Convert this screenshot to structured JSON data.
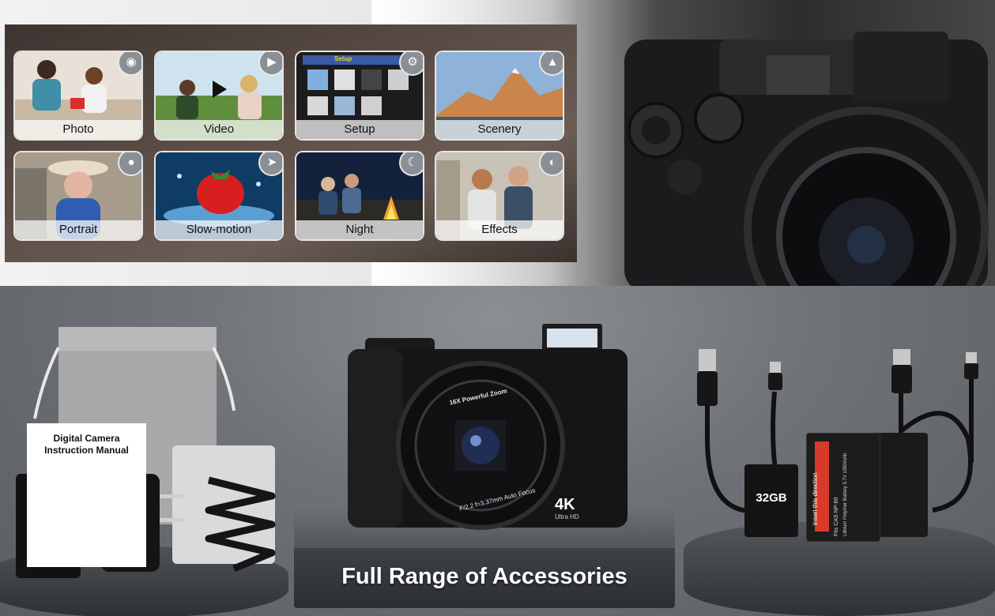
{
  "modes": [
    {
      "label": "Photo",
      "icon": "camera-icon"
    },
    {
      "label": "Video",
      "icon": "video-camera-icon"
    },
    {
      "label": "Setup",
      "icon": "gear-icon"
    },
    {
      "label": "Scenery",
      "icon": "mountain-icon"
    },
    {
      "label": "Portrait",
      "icon": "person-icon"
    },
    {
      "label": "Slow-motion",
      "icon": "running-icon"
    },
    {
      "label": "Night",
      "icon": "moon-icon"
    },
    {
      "label": "Effects",
      "icon": "overlap-circles-icon"
    }
  ],
  "setup_screen_title": "Setup",
  "manual": {
    "title": "Digital Camera\nInstruction Manual"
  },
  "camera": {
    "lens_ring_text": "16X Powerful Zoom",
    "lens_spec_text": "F/2.2 f=3.37mm Auto Focus",
    "resolution_badge": "4K",
    "resolution_sub": "Ultra HD"
  },
  "sd_card": {
    "capacity": "32GB"
  },
  "battery": {
    "arrow_text": "insert this direction",
    "model_text": "Fits CAS NP-60",
    "spec_text": "Lithium Polymer Battery 3.7V 1050mAh"
  },
  "headline": "Full Range of Accessories",
  "colors": {
    "accent_red": "#d83a2a",
    "badge_gray": "#8a8f96"
  }
}
